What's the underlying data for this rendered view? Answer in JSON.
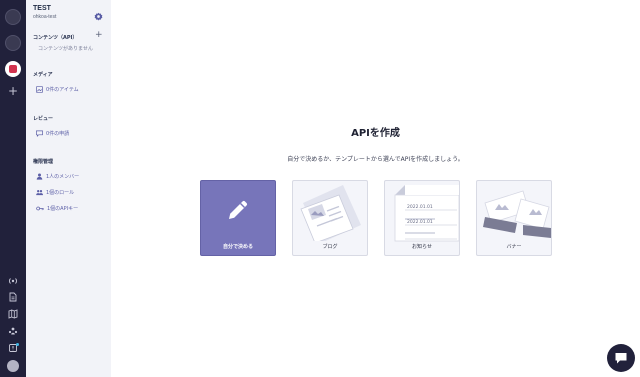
{
  "sidebar": {
    "service_name": "TEST",
    "service_id": "ohkoa-test",
    "sections": {
      "contents": {
        "label": "コンテンツ（API）",
        "empty": "コンテンツがありません"
      },
      "media": {
        "label": "メディア",
        "item": "0件のアイテム"
      },
      "review": {
        "label": "レビュー",
        "item": "0件の申請"
      },
      "permissions": {
        "label": "権限管理",
        "members": "1人のメンバー",
        "roles": "1個のロール",
        "api_keys": "1個のAPIキー"
      }
    }
  },
  "main": {
    "title": "APIを作成",
    "subtitle": "自分で決めるか、テンプレートから選んでAPIを作成しましょう。",
    "cards": [
      {
        "label": "自分で決める",
        "icon": "pencil-icon"
      },
      {
        "label": "ブログ",
        "icon": "blog-template-icon"
      },
      {
        "label": "お知らせ",
        "icon": "news-template-icon",
        "dates": [
          "2022.01.01",
          "2022.01.01"
        ]
      },
      {
        "label": "バナー",
        "icon": "banner-template-icon"
      }
    ]
  },
  "colors": {
    "rail": "#21213b",
    "sidebar": "#f2f3f8",
    "accent": "#7775ba",
    "link": "#5b5ea6"
  }
}
